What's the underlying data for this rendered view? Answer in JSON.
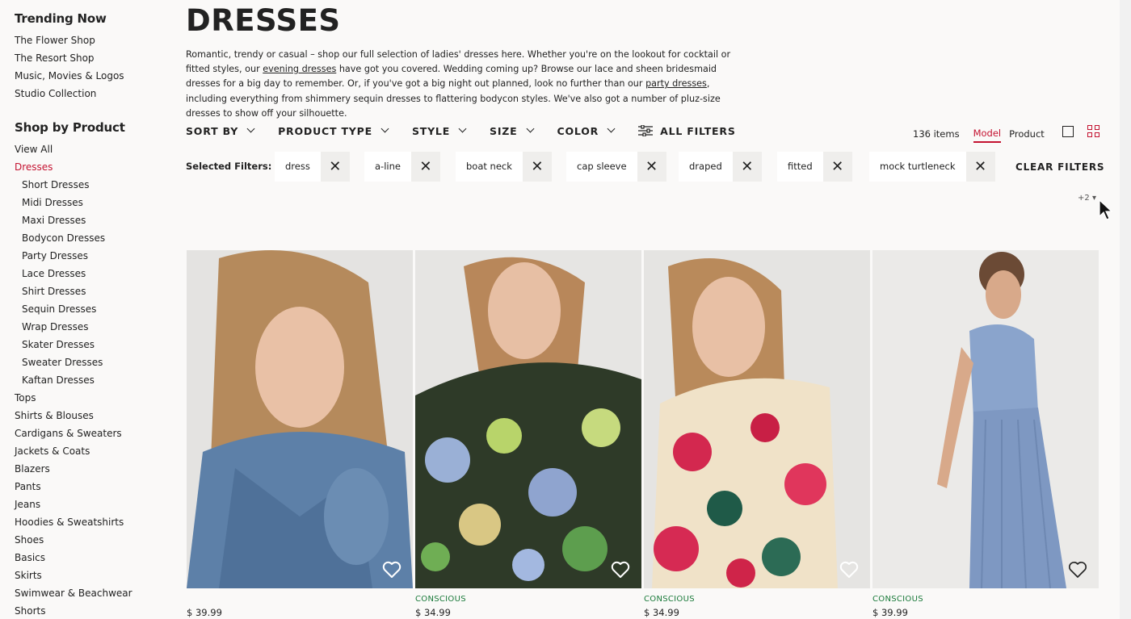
{
  "sidebar": {
    "trending_heading": "Trending Now",
    "trending_items": [
      "The Flower Shop",
      "The Resort Shop",
      "Music, Movies & Logos",
      "Studio Collection"
    ],
    "product_heading": "Shop by Product",
    "product_items": [
      {
        "label": "View All",
        "sub": false,
        "active": false
      },
      {
        "label": "Dresses",
        "sub": false,
        "active": true
      },
      {
        "label": "Short Dresses",
        "sub": true,
        "active": false
      },
      {
        "label": "Midi Dresses",
        "sub": true,
        "active": false
      },
      {
        "label": "Maxi Dresses",
        "sub": true,
        "active": false
      },
      {
        "label": "Bodycon Dresses",
        "sub": true,
        "active": false
      },
      {
        "label": "Party Dresses",
        "sub": true,
        "active": false
      },
      {
        "label": "Lace Dresses",
        "sub": true,
        "active": false
      },
      {
        "label": "Shirt Dresses",
        "sub": true,
        "active": false
      },
      {
        "label": "Sequin Dresses",
        "sub": true,
        "active": false
      },
      {
        "label": "Wrap Dresses",
        "sub": true,
        "active": false
      },
      {
        "label": "Skater Dresses",
        "sub": true,
        "active": false
      },
      {
        "label": "Sweater Dresses",
        "sub": true,
        "active": false
      },
      {
        "label": "Kaftan Dresses",
        "sub": true,
        "active": false
      },
      {
        "label": "Tops",
        "sub": false,
        "active": false
      },
      {
        "label": "Shirts & Blouses",
        "sub": false,
        "active": false
      },
      {
        "label": "Cardigans & Sweaters",
        "sub": false,
        "active": false
      },
      {
        "label": "Jackets & Coats",
        "sub": false,
        "active": false
      },
      {
        "label": "Blazers",
        "sub": false,
        "active": false
      },
      {
        "label": "Pants",
        "sub": false,
        "active": false
      },
      {
        "label": "Jeans",
        "sub": false,
        "active": false
      },
      {
        "label": "Hoodies & Sweatshirts",
        "sub": false,
        "active": false
      },
      {
        "label": "Shoes",
        "sub": false,
        "active": false
      },
      {
        "label": "Basics",
        "sub": false,
        "active": false
      },
      {
        "label": "Skirts",
        "sub": false,
        "active": false
      },
      {
        "label": "Swimwear & Beachwear",
        "sub": false,
        "active": false
      },
      {
        "label": "Shorts",
        "sub": false,
        "active": false
      }
    ]
  },
  "page": {
    "title": "DRESSES",
    "intro": {
      "p1": "Romantic, trendy or casual – shop our full selection of ladies' dresses here. Whether you're on the lookout for cocktail or fitted styles, our ",
      "link1": "evening dresses",
      "p2": " have got you covered. Wedding coming up? Browse our lace and sheen bridesmaid dresses for a big day to remember. Or, if you've got a big night out planned, look no further than our ",
      "link2": "party dresses",
      "p3": ", including everything from shimmery sequin dresses to flattering bodycon styles. We've also got a number of pluz-size dresses to show off your silhouette."
    }
  },
  "filters": {
    "sort_by": "SORT BY",
    "product_type": "PRODUCT TYPE",
    "style": "STYLE",
    "size": "SIZE",
    "color": "COLOR",
    "all_filters": "ALL FILTERS",
    "selected_label": "Selected Filters:",
    "chips": [
      "dress",
      "a-line",
      "boat neck",
      "cap sleeve",
      "draped",
      "fitted",
      "mock turtleneck"
    ],
    "clear": "CLEAR FILTERS",
    "more": "+2"
  },
  "view": {
    "items_count": "136 items",
    "model": "Model",
    "product": "Product"
  },
  "products": [
    {
      "tag": "",
      "price": "$ 39.99"
    },
    {
      "tag": "CONSCIOUS",
      "price": "$ 34.99"
    },
    {
      "tag": "CONSCIOUS",
      "price": "$ 34.99"
    },
    {
      "tag": "CONSCIOUS",
      "price": "$ 39.99"
    }
  ],
  "colors": {
    "accent": "#c41230",
    "conscious": "#1a7a3a",
    "background": "#faf9f8"
  },
  "icons": [
    "close-icon",
    "chevron-down-icon",
    "sliders-icon",
    "single-view-icon",
    "grid-view-icon",
    "heart-icon",
    "caret-down-icon",
    "mouse-cursor-icon"
  ]
}
